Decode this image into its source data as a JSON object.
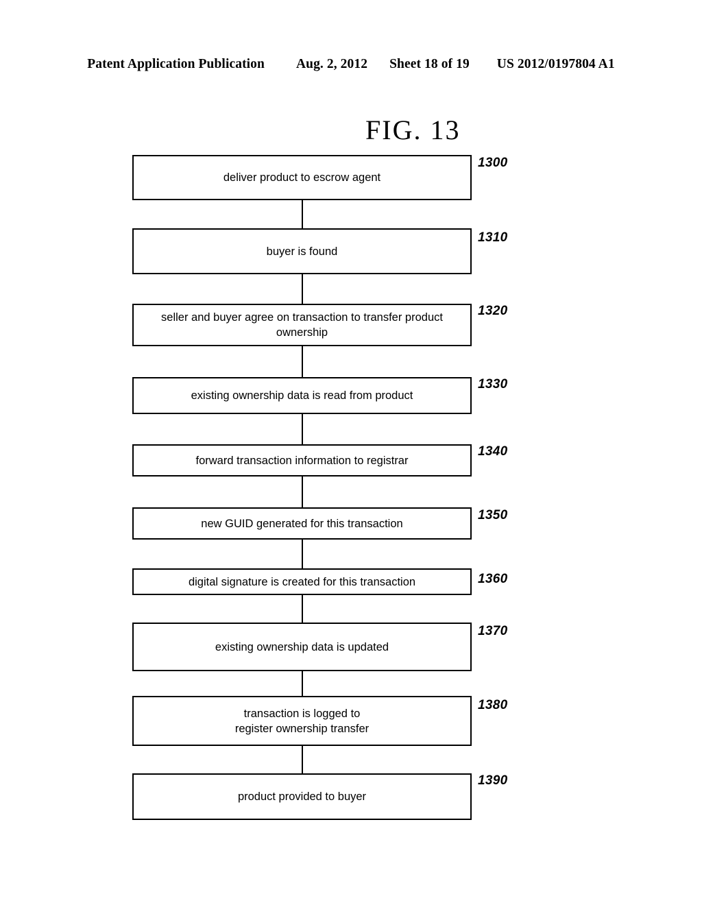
{
  "header": {
    "publication": "Patent Application Publication",
    "date": "Aug. 2, 2012",
    "sheet": "Sheet 18 of 19",
    "patent_number": "US 2012/0197804 A1"
  },
  "figure": {
    "title": "FIG. 13",
    "type": "flowchart",
    "orientation": "vertical",
    "line_color": "#000000",
    "background_color": "#ffffff"
  },
  "flowchart": {
    "nodes": [
      {
        "ref": "1300",
        "text": "deliver product to escrow agent"
      },
      {
        "ref": "1310",
        "text": "buyer is found"
      },
      {
        "ref": "1320",
        "text": "seller and buyer agree on transaction to transfer product\nownership"
      },
      {
        "ref": "1330",
        "text": "existing ownership data is read from product"
      },
      {
        "ref": "1340",
        "text": "forward transaction information to registrar"
      },
      {
        "ref": "1350",
        "text": "new GUID generated for this transaction"
      },
      {
        "ref": "1360",
        "text": "digital signature is created for this transaction"
      },
      {
        "ref": "1370",
        "text": "existing ownership data is updated"
      },
      {
        "ref": "1380",
        "text": "transaction is logged to\nregister ownership transfer"
      },
      {
        "ref": "1390",
        "text": "product provided to buyer"
      }
    ]
  }
}
